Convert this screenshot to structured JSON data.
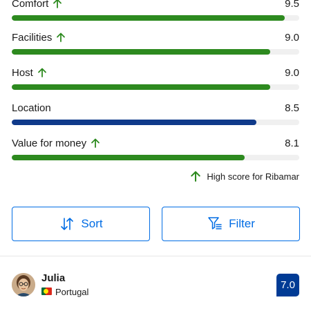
{
  "scores": [
    {
      "label": "Comfort",
      "value": "9.5",
      "fraction": 0.95,
      "high": true,
      "color": "#2d8a1f"
    },
    {
      "label": "Facilities",
      "value": "9.0",
      "fraction": 0.9,
      "high": true,
      "color": "#2d8a1f"
    },
    {
      "label": "Host",
      "value": "9.0",
      "fraction": 0.9,
      "high": true,
      "color": "#2d8a1f"
    },
    {
      "label": "Location",
      "value": "8.5",
      "fraction": 0.85,
      "high": false,
      "color": "#0f3a8a"
    },
    {
      "label": "Value for money",
      "value": "8.1",
      "fraction": 0.81,
      "high": true,
      "color": "#2d8a1f"
    }
  ],
  "high_score_note": "High score for Ribamar",
  "accent_green": "#2d8a1f",
  "accent_blue": "#006ce4",
  "sort": {
    "label": "Sort",
    "icon": "sort-arrows-icon"
  },
  "filter": {
    "label": "Filter",
    "icon": "filter-funnel-icon"
  },
  "review": {
    "name": "Julia",
    "country": "Portugal",
    "flag": "portugal-flag-icon",
    "score": "7.0"
  }
}
